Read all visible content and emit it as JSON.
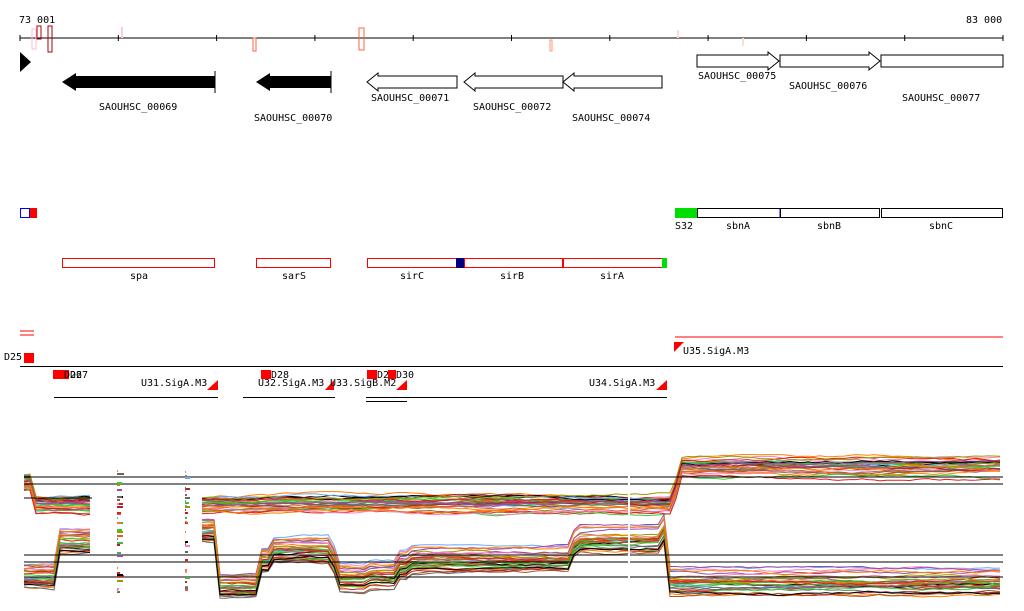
{
  "axis": {
    "start": "73 001",
    "end": "83 000"
  },
  "genes": [
    {
      "id": "SAOUHSC_00069"
    },
    {
      "id": "SAOUHSC_00070"
    },
    {
      "id": "SAOUHSC_00071"
    },
    {
      "id": "SAOUHSC_00072"
    },
    {
      "id": "SAOUHSC_00074"
    },
    {
      "id": "SAOUHSC_00075"
    },
    {
      "id": "SAOUHSC_00076"
    },
    {
      "id": "SAOUHSC_00077"
    }
  ],
  "annotations": [
    "S32",
    "sbnA",
    "sbnB",
    "sbnC",
    "spa",
    "sarS",
    "sirC",
    "sirB",
    "sirA"
  ],
  "segments": [
    "D25",
    "D26",
    "D27",
    "D28",
    "D29",
    "D30",
    "U31.SigA.M3",
    "U32.SigA.M3",
    "U33.SigB.M2",
    "U34.SigA.M3",
    "U35.SigA.M3"
  ],
  "colors": {
    "red": "#ff0000",
    "green": "#00dd00",
    "navy": "#000080",
    "blue": "#0000ff"
  }
}
